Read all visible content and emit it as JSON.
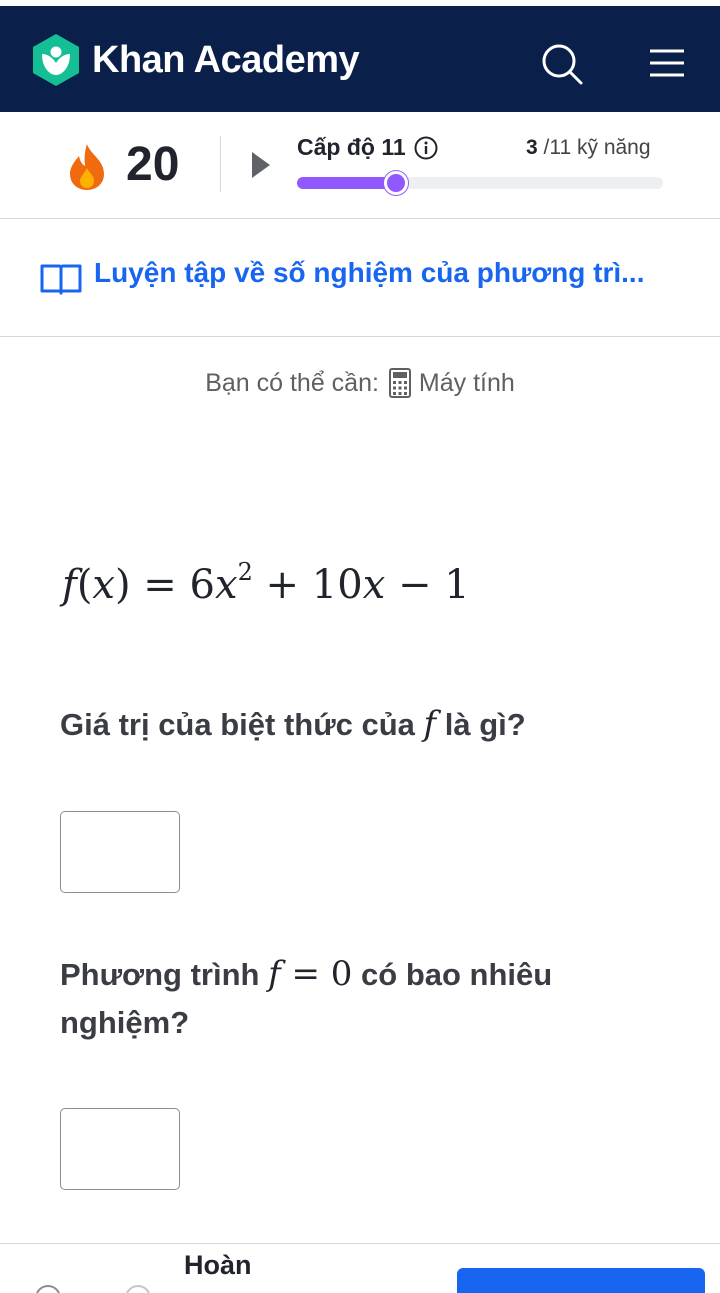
{
  "header": {
    "brand": "Khan Academy",
    "brand_color": "#0a1f4a",
    "logo_color": "#14bf96",
    "search_icon": "search-icon",
    "menu_icon": "hamburger-menu-icon"
  },
  "progress": {
    "streak": "20",
    "level_label": "Cấp độ 11",
    "skills_done": "3",
    "skills_total": " /11 kỹ năng",
    "level_progress": 0.27,
    "accent_color": "#9059ff"
  },
  "lesson": {
    "title": "Luyện tập về số nghiệm của phương trì...",
    "link_color": "#1865f2"
  },
  "hint": {
    "prefix": "Bạn có thể cần:",
    "tool": "Máy tính"
  },
  "exercise": {
    "formula": {
      "lhs_fn": "f",
      "lhs_arg": "x",
      "coef1": "6",
      "var1": "x",
      "exp1": "2",
      "plus": " + ",
      "coef2": "10",
      "var2": "x",
      "minus": " − ",
      "const": "1"
    },
    "q1": {
      "before": "Giá trị của biệt thức của ",
      "fn": "f",
      "after": " là gì?",
      "answer_value": ""
    },
    "q2": {
      "before": "Phương trình ",
      "fn": "f",
      "eq": " = ",
      "zero": "0",
      "after": " có bao nhiêu nghiệm?",
      "answer_value": ""
    }
  },
  "footer": {
    "label": "Hoàn"
  }
}
